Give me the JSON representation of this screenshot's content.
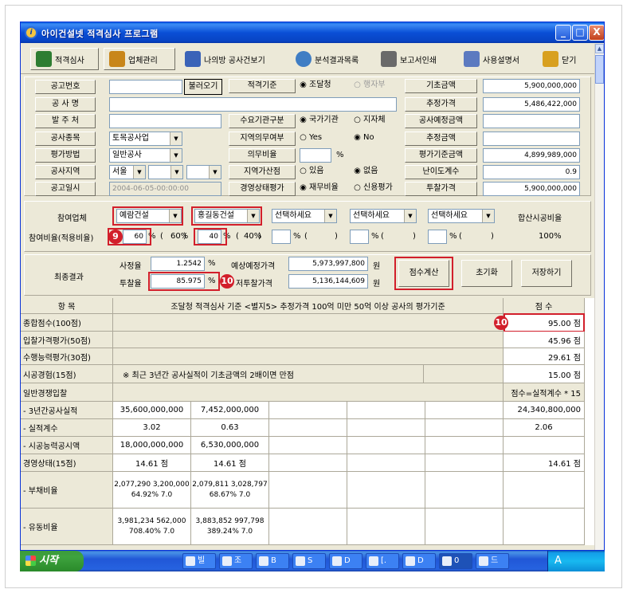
{
  "window": {
    "title": "아이건설넷 적격심사 프로그램",
    "min": "_",
    "max": "□",
    "close": "X"
  },
  "toolbar": [
    {
      "label": "적격심사",
      "icon": "book-icon",
      "color": "#2e7d32"
    },
    {
      "label": "업체관리",
      "icon": "building-icon",
      "color": "#c8861a"
    },
    {
      "label": "나의방 공사건보기",
      "icon": "person-icon",
      "color": "#3a63b8"
    },
    {
      "label": "분석결과목록",
      "icon": "globe-icon",
      "color": "#3f7dc4"
    },
    {
      "label": "보고서인쇄",
      "icon": "printer-icon",
      "color": "#6a6a6a"
    },
    {
      "label": "사용설명서",
      "icon": "person-help-icon",
      "color": "#5c7ac0"
    },
    {
      "label": "닫기",
      "icon": "exit-icon",
      "color": "#d8a020"
    }
  ],
  "form": {
    "notice_no_label": "공고번호",
    "load_button": "불러오기",
    "criteria_label": "적격기준",
    "criteria_opt1": "조달청",
    "criteria_opt2": "행자부",
    "base_amount_label": "기초금액",
    "base_amount": "5,900,000,000",
    "project_name_label": "공 사 명",
    "est_price_label": "추정가격",
    "est_price": "5,486,422,000",
    "client_label": "발 주 처",
    "demand_type_label": "수요기관구분",
    "demand_opt1": "국가기관",
    "demand_opt2": "지자체",
    "exp_price_amount_label": "공사예정금액",
    "category_label": "공사종목",
    "category": "토목공사업",
    "regional_label": "지역의무여부",
    "regional_yes": "Yes",
    "regional_no": "No",
    "est_amount_label": "추정금액",
    "eval_method_label": "평가방법",
    "eval_method": "일반공사",
    "duty_ratio_label": "의무비율",
    "duty_ratio_unit": "%",
    "eval_base_amount_label": "평가기준금액",
    "eval_base_amount": "4,899,989,000",
    "region_label": "공사지역",
    "region": "서울",
    "region_bonus_label": "지역가산점",
    "bonus_opt1": "있음",
    "bonus_opt2": "없음",
    "difficulty_label": "난이도계수",
    "difficulty": "0.9",
    "notice_date_label": "공고일시",
    "notice_date": "2004-06-05-00:00:00",
    "mgmt_eval_label": "경영상태평가",
    "mgmt_opt1": "재무비율",
    "mgmt_opt2": "신용평가",
    "bid_price_label": "투찰가격",
    "bid_price": "5,900,000,000"
  },
  "participants": {
    "label": "참여업체",
    "ratio_label": "참여비율(적용비율)",
    "companies": [
      {
        "name": "예람건설",
        "ratio": "60",
        "applied": "60%"
      },
      {
        "name": "홍길동건설",
        "ratio": "40",
        "applied": "40%"
      },
      {
        "name": "선택하세요",
        "ratio": "",
        "applied": ""
      },
      {
        "name": "선택하세요",
        "ratio": "",
        "applied": ""
      },
      {
        "name": "선택하세요",
        "ratio": "",
        "applied": ""
      }
    ],
    "total_label": "합산시공비율",
    "total": "100%",
    "pct": "%",
    "paren_open": "(",
    "paren_close": ")"
  },
  "result": {
    "label": "최종결과",
    "assess_rate_label": "사정율",
    "assess_rate": "1.2542",
    "bid_rate_label": "투찰율",
    "bid_rate": "85.975",
    "expected_price_label": "예상예정가격",
    "expected_price": "5,973,997,800",
    "lowest_bid_label": "저투찰가격",
    "lowest_bid": "5,136,144,609",
    "unit_pct": "%",
    "unit_won": "원",
    "calc_button": "점수계산",
    "reset_button": "초기화",
    "save_button": "저장하기"
  },
  "badges": {
    "b9": "9",
    "b10": "10"
  },
  "grid": {
    "header_item": "항 목",
    "header_desc": "조달청 적격심사 기준 <별지5> 추정가격 100억 미만 50억 이상 공사의 평가기준",
    "header_score": "점 수",
    "rows": [
      {
        "item": "종합점수(100점)",
        "desc": "",
        "score": "95.00 점"
      },
      {
        "item": "입찰가격평가(50점)",
        "desc": "",
        "score": "45.96 점"
      },
      {
        "item": "수행능력평가(30점)",
        "desc": "",
        "score": "29.61 점"
      },
      {
        "item": "시공경험(15점)",
        "desc": "※ 최근 3년간 공사실적이 기초금액의 2배이면 만점",
        "score": "15.00 점"
      },
      {
        "item": "일반경쟁입찰",
        "desc": "",
        "score": "점수=실적계수 * 15"
      }
    ],
    "detail_rows": [
      {
        "item": "- 3년간공사실적",
        "c1": "35,600,000,000",
        "c2": "7,452,000,000",
        "score": "24,340,800,000"
      },
      {
        "item": "- 실적계수",
        "c1": "3.02",
        "c2": "0.63",
        "score": "2.06"
      },
      {
        "item": "- 시공능력공시액",
        "c1": "18,000,000,000",
        "c2": "6,530,000,000",
        "score": ""
      },
      {
        "item": "경영상태(15점)",
        "c1": "14.61 점",
        "c2": "14.61 점",
        "score": "14.61 점"
      }
    ],
    "debt": {
      "item": "- 부채비율",
      "c1a": "2,077,290  3,200,000",
      "c1b": "64.92%    7.0",
      "c2a": "2,079,811  3,028,797",
      "c2b": "68.67%    7.0"
    },
    "liquidity": {
      "item": "- 유동비율",
      "c1a": "3,981,234  562,000",
      "c1b": "708.40%   7.0",
      "c2a": "3,883,852  997,798",
      "c2b": "389.24%   7.0"
    }
  },
  "taskbar": {
    "start": "시작",
    "tasks": [
      "빌",
      "조",
      "B",
      "S",
      "D",
      "[.",
      "D",
      "0",
      "드"
    ],
    "tray_text": "A"
  }
}
